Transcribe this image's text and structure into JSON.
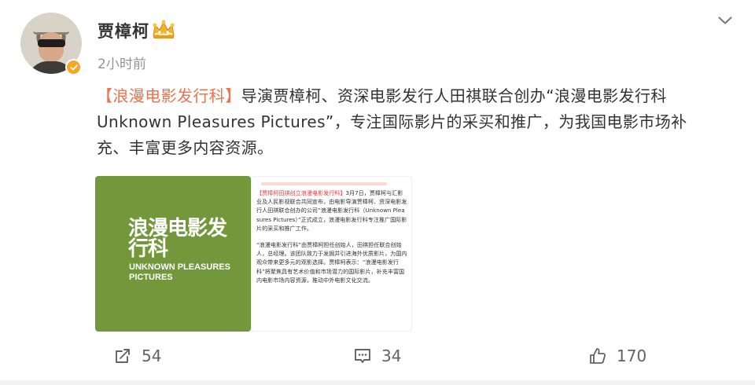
{
  "user": {
    "name": "贾樟柯",
    "post_time": "2小时前"
  },
  "post": {
    "topic": "【浪漫电影发行科】",
    "text_line1": "导演贾樟柯、资深电影发行人田祺联合创办“浪漫电影发行科",
    "text_line2": "Unknown Pleasures Pictures”，专注国际影片的采买和推广，为我国电影市场补",
    "text_line3": "充、丰富更多内容资源。"
  },
  "images": [
    {
      "logo_cn": "浪漫电影发行科",
      "logo_en": "UNKNOWN PLEASURES PICTURES",
      "background": "#73983b"
    },
    {
      "para1_highlight": "【贾樟柯田祺创立浪漫电影发行科】",
      "para1": "3月7日，贾樟柯与汇影业及人民影视联合共同宣布，由电影导演贾樟柯、资深电影发行人田祺联合创办的公司“浪漫电影发行科（Unknown Pleasures Pictures）”正式成立，浪漫电影发行科专注推广国际影片的采买和推广工作。",
      "para2": "“浪漫电影发行科”由贾樟柯担任创始人，田祺担任联合创始人，总经理。该团队致力于发掘并引进海外优质影片，为国内观众带来更多元的观影选择。贾樟柯表示：“浪漫电影发行科”将聚焦具有艺术价值和市场潜力的国际影片，补充丰富国内电影市场内容资源，推动中外电影文化交流。"
    }
  ],
  "actions": {
    "forward_count": "54",
    "comment_count": "34",
    "like_count": "170"
  },
  "colors": {
    "topic": "#eb7350",
    "badge": "#f5a623",
    "muted": "#939393"
  },
  "icons": {
    "chevron": "chevron-down-icon",
    "forward": "share-icon",
    "comment": "comment-icon",
    "like": "thumbs-up-icon",
    "verify": "verified-badge-icon",
    "crown": "crown-icon"
  }
}
